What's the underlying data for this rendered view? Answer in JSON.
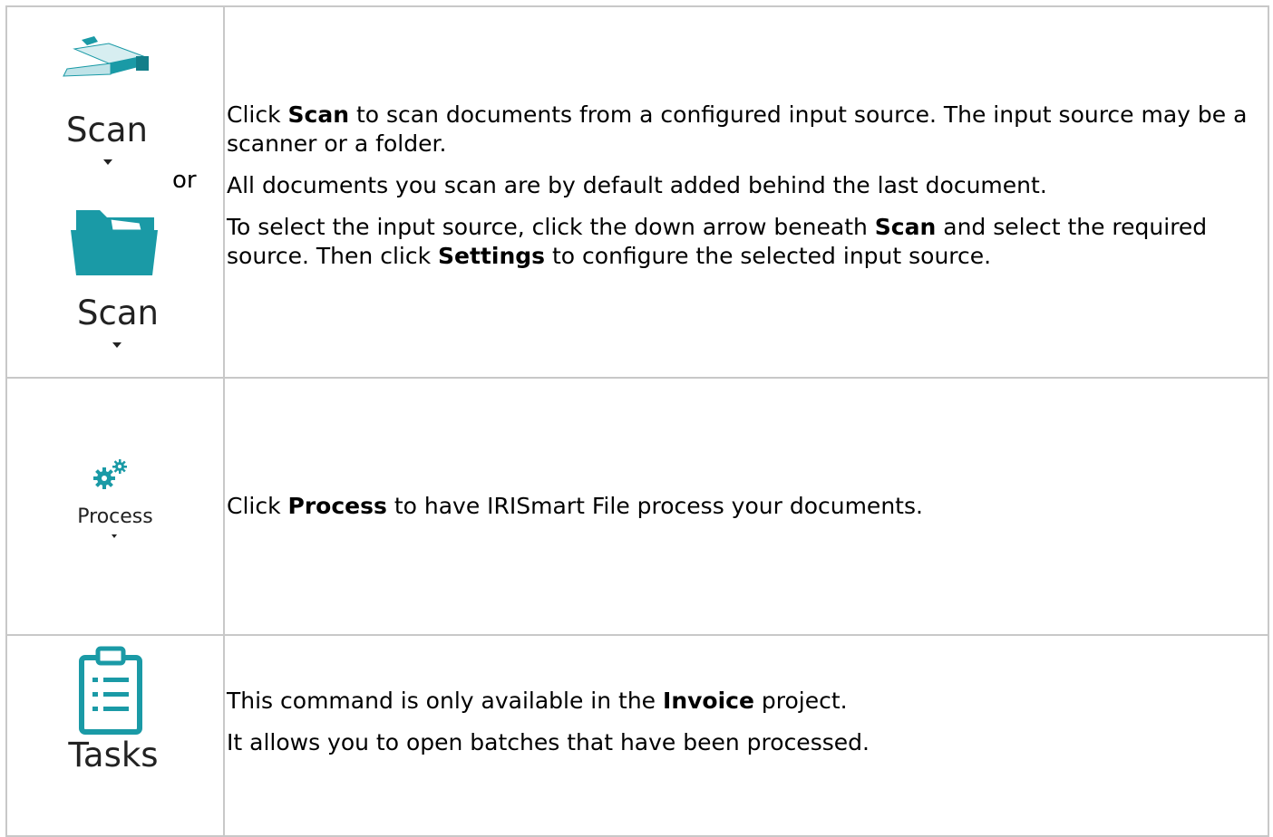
{
  "rows": [
    {
      "icons": [
        {
          "icon": "scanner-icon",
          "label": "Scan"
        },
        {
          "icon": "folder-icon",
          "label": "Scan"
        }
      ],
      "or_text": "or",
      "paragraphs": [
        {
          "parts": [
            "Click ",
            "Scan",
            " to scan documents from a configured input source. The input source may be a scanner or a folder."
          ]
        },
        {
          "parts": [
            "All documents you scan are by default added behind the last document."
          ]
        },
        {
          "parts": [
            "To select the input source, click the down arrow beneath ",
            "Scan",
            " and select the required source. Then click ",
            "Settings",
            " to configure the selected input source."
          ]
        }
      ]
    },
    {
      "icons": [
        {
          "icon": "gears-icon",
          "label": "Process"
        }
      ],
      "paragraphs": [
        {
          "parts": [
            "Click ",
            "Process",
            " to have IRISmart File process your documents."
          ]
        }
      ]
    },
    {
      "icons": [
        {
          "icon": "clipboard-list-icon",
          "label": "Tasks"
        }
      ],
      "paragraphs": [
        {
          "parts": [
            "This command is only available in the ",
            "Invoice",
            " project."
          ]
        },
        {
          "parts": [
            "It allows you to open batches that have been processed."
          ]
        }
      ]
    }
  ],
  "colors": {
    "icon_teal": "#1a9aa6",
    "border": "#c8c8c8"
  }
}
